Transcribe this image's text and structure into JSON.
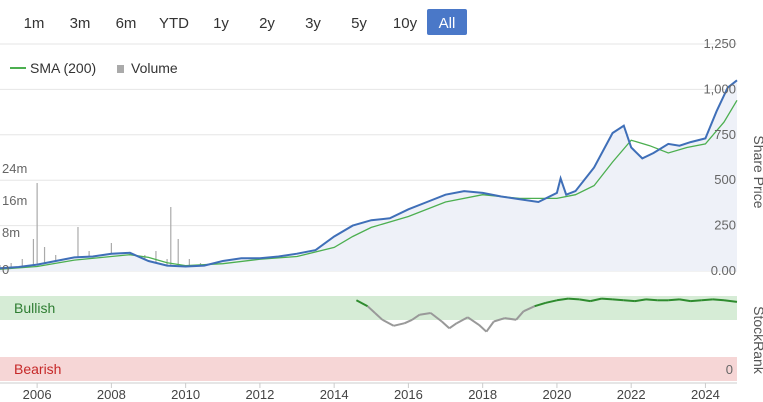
{
  "range_selector": {
    "buttons": [
      "1m",
      "3m",
      "6m",
      "YTD",
      "1y",
      "2y",
      "3y",
      "5y",
      "10y",
      "All"
    ],
    "selected": "All",
    "selected_color": "#4a78c8"
  },
  "legend": {
    "sma_label": "SMA (200)",
    "volume_label": "Volume",
    "sma_color": "#4caf50",
    "volume_color": "#aaaaaa"
  },
  "stockrank": {
    "axis_label": "StockRank",
    "bullish_label": "Bullish",
    "bearish_label": "Bearish",
    "zero_label": "0",
    "bullish_color": "#d6ecd6",
    "bearish_color": "#f6d6d6",
    "bullish_text_color": "#2e7d32",
    "bearish_text_color": "#c62828"
  },
  "chart_data": [
    {
      "type": "line",
      "ylabel": "Share Price",
      "ylim": [
        0,
        1250
      ],
      "yticks": [
        "0.00",
        "250",
        "500",
        "750",
        "1,000",
        "1,250"
      ],
      "xlim": [
        2005.0,
        2024.85
      ],
      "xticks": [
        "2006",
        "2008",
        "2010",
        "2012",
        "2014",
        "2016",
        "2018",
        "2020",
        "2022",
        "2024"
      ],
      "series": [
        {
          "name": "Share Price",
          "color": "#3f6fb8",
          "x": [
            2005.0,
            2005.5,
            2006.0,
            2006.5,
            2007.0,
            2007.5,
            2008.0,
            2008.5,
            2009.0,
            2009.5,
            2010.0,
            2010.5,
            2011.0,
            2011.5,
            2012.0,
            2012.5,
            2013.0,
            2013.5,
            2014.0,
            2014.5,
            2015.0,
            2015.5,
            2016.0,
            2016.5,
            2017.0,
            2017.5,
            2018.0,
            2018.5,
            2019.0,
            2019.5,
            2020.0,
            2020.1,
            2020.25,
            2020.5,
            2021.0,
            2021.5,
            2021.8,
            2022.0,
            2022.3,
            2022.6,
            2023.0,
            2023.3,
            2023.6,
            2024.0,
            2024.3,
            2024.6,
            2024.85
          ],
          "y": [
            15,
            22,
            35,
            55,
            75,
            80,
            95,
            100,
            55,
            30,
            25,
            30,
            55,
            70,
            70,
            80,
            95,
            115,
            190,
            250,
            280,
            290,
            340,
            380,
            420,
            440,
            430,
            410,
            395,
            380,
            430,
            510,
            420,
            440,
            570,
            760,
            800,
            680,
            620,
            650,
            700,
            690,
            710,
            730,
            880,
            1010,
            1050
          ]
        },
        {
          "name": "SMA (200)",
          "color": "#4caf50",
          "x": [
            2005.0,
            2006.0,
            2007.0,
            2008.0,
            2008.5,
            2009.0,
            2009.5,
            2010.0,
            2011.0,
            2012.0,
            2013.0,
            2014.0,
            2014.5,
            2015.0,
            2016.0,
            2017.0,
            2018.0,
            2019.0,
            2020.0,
            2020.5,
            2021.0,
            2021.5,
            2022.0,
            2022.5,
            2023.0,
            2023.5,
            2024.0,
            2024.5,
            2024.85
          ],
          "y": [
            10,
            25,
            60,
            80,
            90,
            75,
            45,
            30,
            40,
            65,
            80,
            130,
            190,
            240,
            300,
            380,
            420,
            400,
            400,
            420,
            470,
            600,
            720,
            690,
            650,
            680,
            700,
            820,
            940
          ]
        }
      ]
    },
    {
      "type": "bar",
      "name": "Volume",
      "color": "#aaaaaa",
      "ylim": [
        0,
        24
      ],
      "yticks": [
        "0",
        "8m",
        "16m",
        "24m"
      ],
      "x": [
        2005.0,
        2005.3,
        2005.6,
        2005.9,
        2006.0,
        2006.2,
        2006.5,
        2006.8,
        2007.1,
        2007.4,
        2007.7,
        2008.0,
        2008.3,
        2008.6,
        2008.9,
        2009.2,
        2009.5,
        2009.6,
        2009.8,
        2010.1,
        2010.4,
        2010.7,
        2011.0,
        2011.5,
        2012.0,
        2012.5,
        2013.0,
        2013.5,
        2014.0,
        2014.5,
        2015.0,
        2015.5,
        2016.0,
        2016.5,
        2017.0,
        2017.5,
        2018.0,
        2018.5,
        2019.0,
        2019.5,
        2020.0,
        2020.5,
        2021.0,
        2021.5,
        2022.0,
        2022.5,
        2023.0,
        2023.5,
        2024.0,
        2024.5,
        2024.8
      ],
      "values": [
        1.5,
        2,
        3,
        8,
        22,
        6,
        4,
        3,
        11,
        5,
        3,
        7,
        4,
        3,
        4,
        5,
        3,
        16,
        8,
        3,
        2,
        2,
        2,
        1.5,
        1.5,
        1.5,
        1.5,
        1.5,
        1.5,
        1.5,
        1.5,
        1.5,
        1.5,
        1.5,
        1.5,
        1.5,
        1.5,
        1.5,
        1.5,
        1.5,
        2,
        1.5,
        1.5,
        1.5,
        1.5,
        1.5,
        1.5,
        1.5,
        2.5,
        3,
        2
      ]
    },
    {
      "type": "line",
      "name": "StockRank",
      "bullish_color": "#2e8b2e",
      "neutral_color": "#999999",
      "ylim": [
        0,
        100
      ],
      "x": [
        2014.6,
        2014.9,
        2015.1,
        2015.3,
        2015.6,
        2015.9,
        2016.1,
        2016.3,
        2016.6,
        2016.9,
        2017.1,
        2017.3,
        2017.6,
        2017.9,
        2018.1,
        2018.3,
        2018.6,
        2018.9,
        2019.1,
        2019.4,
        2019.7,
        2020.0,
        2020.3,
        2020.6,
        2020.9,
        2021.2,
        2021.5,
        2021.8,
        2022.1,
        2022.4,
        2022.7,
        2023.0,
        2023.3,
        2023.6,
        2023.9,
        2024.2,
        2024.5,
        2024.85
      ],
      "values": [
        95,
        88,
        80,
        72,
        65,
        68,
        72,
        78,
        80,
        70,
        62,
        68,
        75,
        66,
        58,
        70,
        74,
        72,
        82,
        88,
        92,
        95,
        97,
        96,
        94,
        97,
        96,
        95,
        94,
        96,
        95,
        95,
        96,
        94,
        95,
        96,
        95,
        93
      ]
    }
  ]
}
